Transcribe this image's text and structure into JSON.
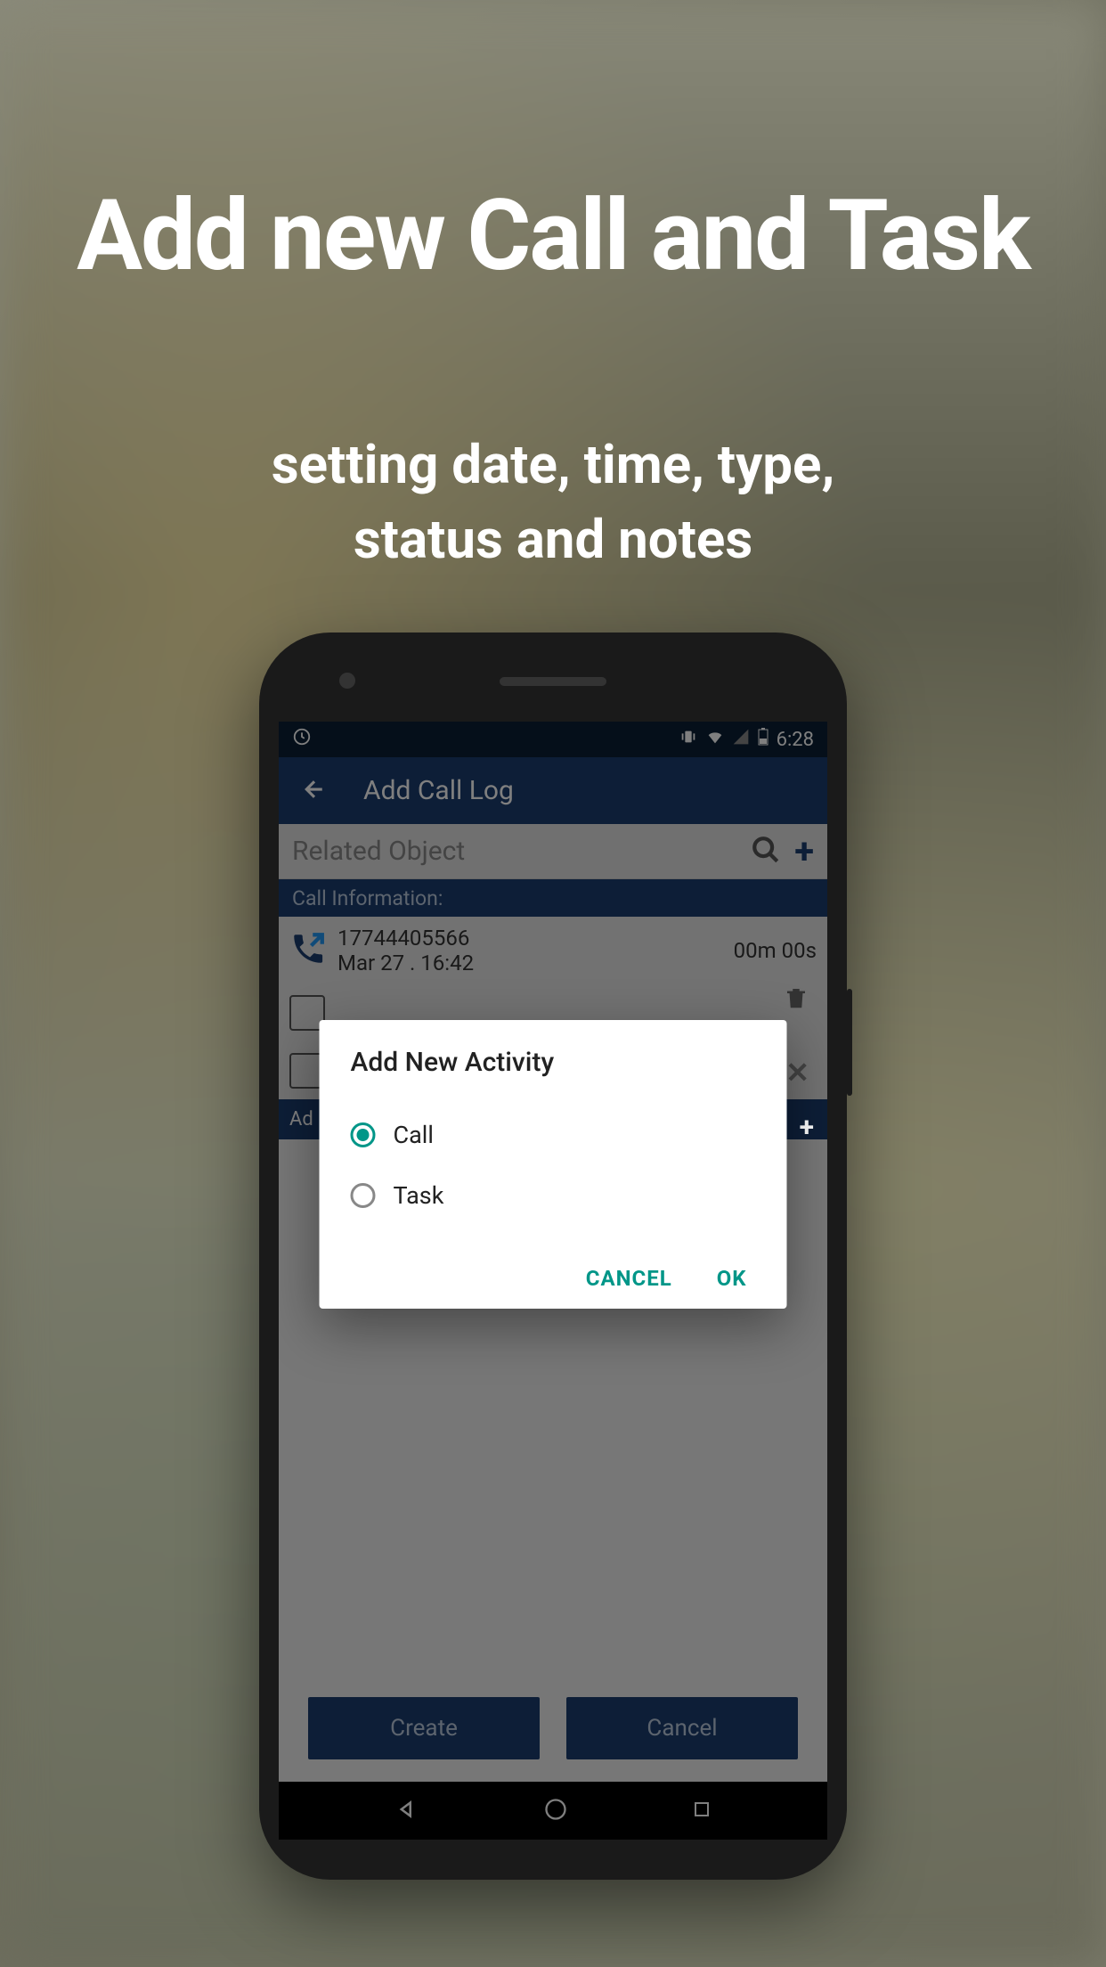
{
  "promo": {
    "title": "Add new Call and Task",
    "subtitle_line1": "setting date, time, type,",
    "subtitle_line2": "status and notes"
  },
  "status": {
    "time": "6:28"
  },
  "appbar": {
    "title": "Add Call Log"
  },
  "search": {
    "placeholder": "Related Object"
  },
  "section": {
    "call_info": "Call Information:"
  },
  "call": {
    "number": "17744405566",
    "date": "Mar 27 . 16:42",
    "duration": "00m 00s"
  },
  "addon": {
    "label": "Ad"
  },
  "dialog": {
    "title": "Add New Activity",
    "option_call": "Call",
    "option_task": "Task",
    "cancel": "CANCEL",
    "ok": "OK"
  },
  "buttons": {
    "create": "Create",
    "cancel": "Cancel"
  }
}
